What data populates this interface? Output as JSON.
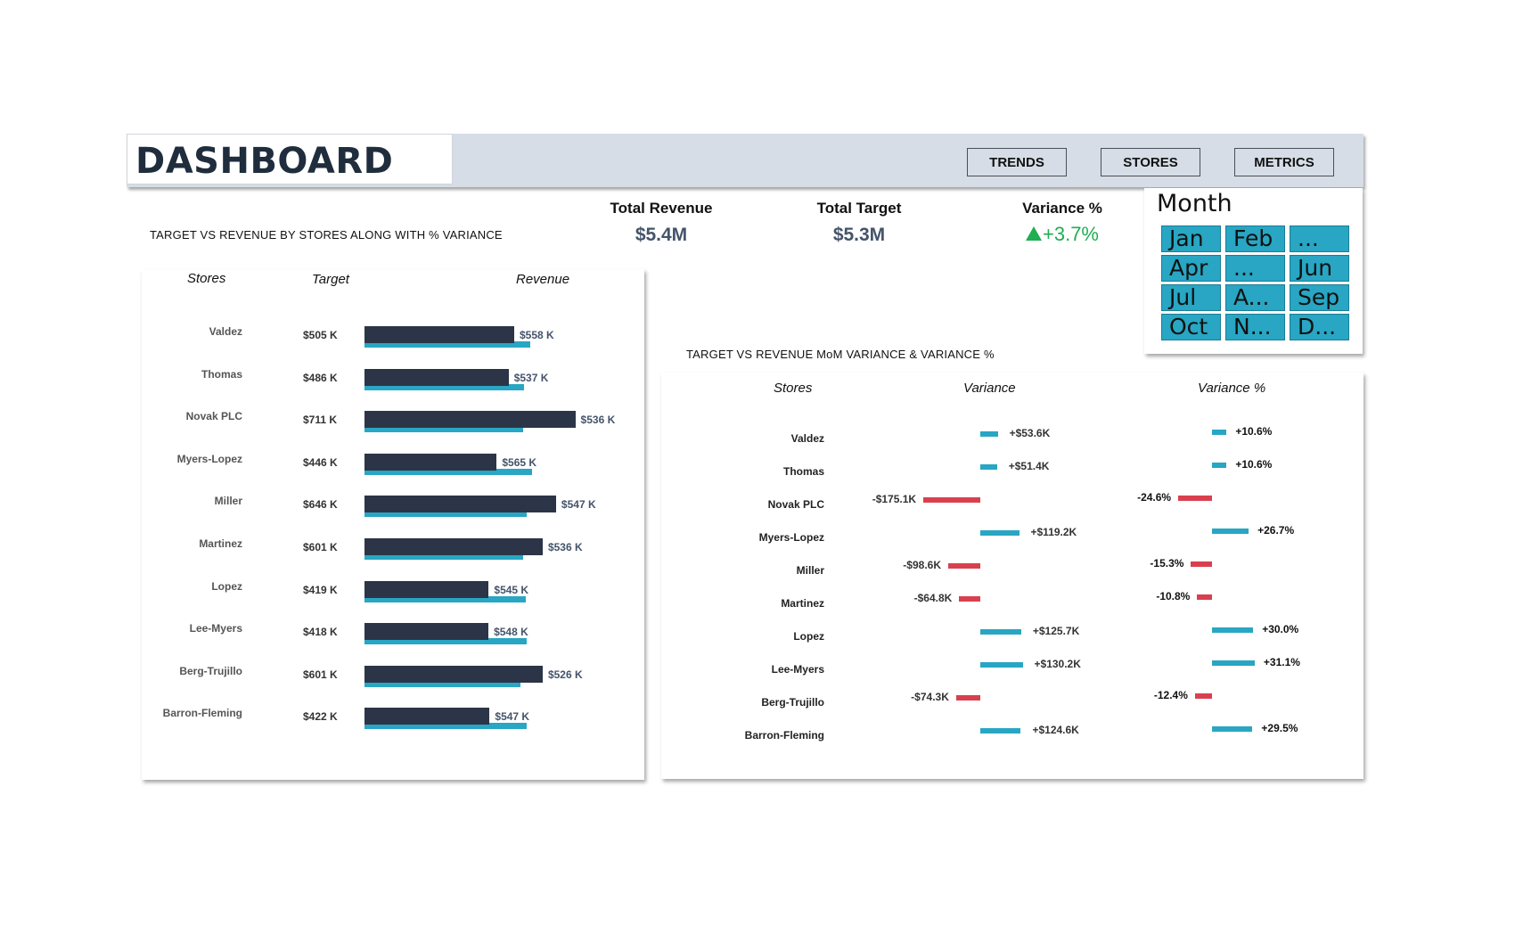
{
  "header": {
    "title": "DASHBOARD",
    "nav": [
      "TRENDS",
      "STORES",
      "METRICS"
    ]
  },
  "kpis": {
    "total_revenue_label": "Total Revenue",
    "total_revenue_value": "$5.4M",
    "total_target_label": "Total Target",
    "total_target_value": "$5.3M",
    "variance_label": "Variance %",
    "variance_value": "+3.7%",
    "variance_icon": "triangle-up-icon"
  },
  "month_slicer": {
    "title": "Month",
    "months": [
      "Jan",
      "Feb",
      "...",
      "Apr",
      "...",
      "Jun",
      "Jul",
      "A...",
      "Sep",
      "Oct",
      "N...",
      "D..."
    ]
  },
  "left_chart": {
    "title": "TARGET VS REVENUE BY STORES ALONG WITH % VARIANCE",
    "headers": [
      "Stores",
      "Target",
      "Revenue"
    ]
  },
  "right_chart": {
    "title": "TARGET VS REVENUE MoM VARIANCE & VARIANCE %",
    "headers": [
      "Stores",
      "Variance",
      "Variance %"
    ]
  },
  "colors": {
    "target_bar": "#2b3547",
    "revenue_bar": "#28a6c3",
    "positive": "#28a6c3",
    "negative": "#d9404f",
    "kpi_green": "#1fae52"
  },
  "chart_data": {
    "type": "bar",
    "categories": [
      "Valdez",
      "Thomas",
      "Novak PLC",
      "Myers-Lopez",
      "Miller",
      "Martinez",
      "Lopez",
      "Lee-Myers",
      "Berg-Trujillo",
      "Barron-Fleming"
    ],
    "target_labels": [
      "$505 K",
      "$486 K",
      "$711 K",
      "$446 K",
      "$646 K",
      "$601 K",
      "$419 K",
      "$418 K",
      "$601 K",
      "$422 K"
    ],
    "revenue_labels": [
      "$558 K",
      "$537 K",
      "$536 K",
      "$565 K",
      "$547 K",
      "$536 K",
      "$545 K",
      "$548 K",
      "$526 K",
      "$547 K"
    ],
    "series": [
      {
        "name": "Target",
        "values": [
          505,
          486,
          711,
          446,
          646,
          601,
          419,
          418,
          601,
          422
        ]
      },
      {
        "name": "Revenue",
        "values": [
          558,
          537,
          536,
          565,
          547,
          536,
          545,
          548,
          526,
          547
        ]
      }
    ],
    "variance_labels": [
      "+$53.6K",
      "+$51.4K",
      "-$175.1K",
      "+$119.2K",
      "-$98.6K",
      "-$64.8K",
      "+$125.7K",
      "+$130.2K",
      "-$74.3K",
      "+$124.6K"
    ],
    "variance_values": [
      53.6,
      51.4,
      -175.1,
      119.2,
      -98.6,
      -64.8,
      125.7,
      130.2,
      -74.3,
      124.6
    ],
    "variance_pct_labels": [
      "+10.6%",
      "+10.6%",
      "-24.6%",
      "+26.7%",
      "-15.3%",
      "-10.8%",
      "+30.0%",
      "+31.1%",
      "-12.4%",
      "+29.5%"
    ],
    "variance_pct_values": [
      10.6,
      10.6,
      -24.6,
      26.7,
      -15.3,
      -10.8,
      30.0,
      31.1,
      -12.4,
      29.5
    ]
  }
}
